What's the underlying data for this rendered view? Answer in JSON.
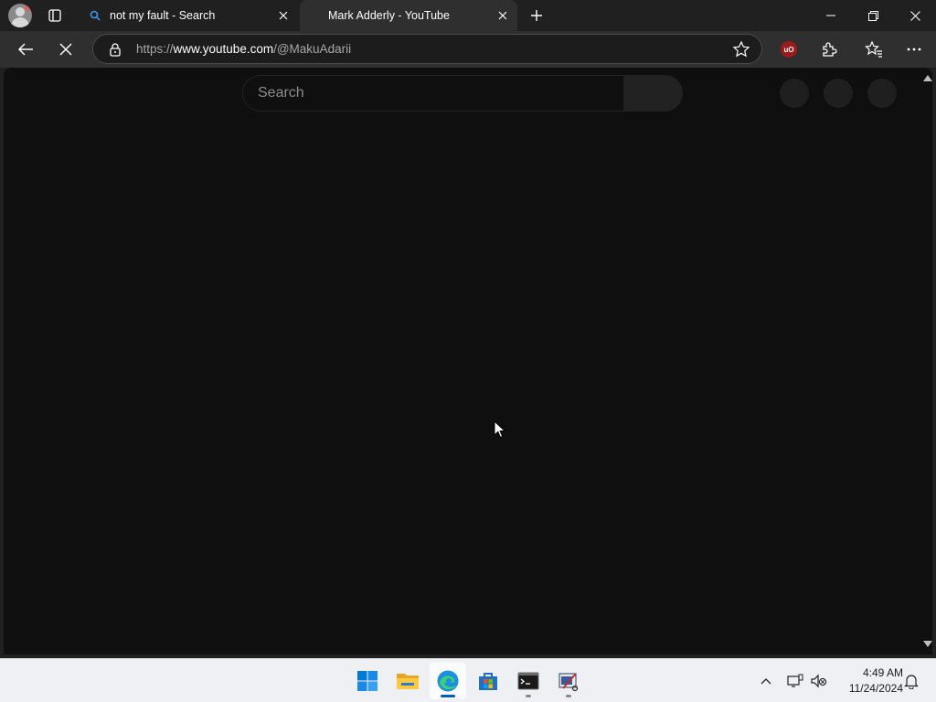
{
  "browser": {
    "tabs": [
      {
        "title": "not my fault - Search",
        "active": false,
        "icon": "search-icon"
      },
      {
        "title": "Mark Adderly - YouTube",
        "active": true,
        "icon": "none"
      }
    ],
    "address": {
      "scheme": "https://",
      "host": "www.youtube.com",
      "path": "/@MakuAdarii"
    },
    "extension_ublock_label": "uO"
  },
  "page": {
    "search_placeholder": "Search"
  },
  "taskbar": {
    "apps": [
      "windows-start",
      "file-explorer",
      "microsoft-edge",
      "microsoft-store",
      "terminal",
      "snipping-tool"
    ],
    "time": "4:49 AM",
    "date": "11/24/2024"
  },
  "colors": {
    "content_bg": "#0f0f0f",
    "chrome_bg": "#202020",
    "toolbar_bg": "#2f2f2f",
    "accent": "#005fb8"
  }
}
